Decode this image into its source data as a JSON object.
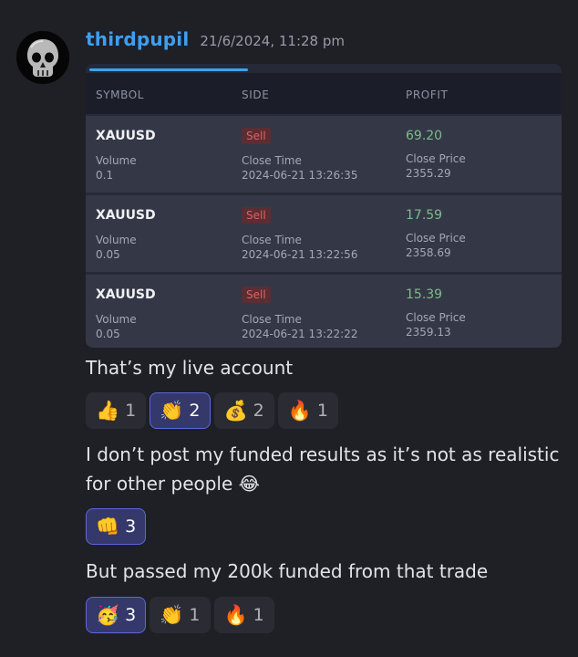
{
  "author": {
    "username": "thirdpupil",
    "timestamp": "21/6/2024, 11:28 pm"
  },
  "trade_card": {
    "columns": [
      "SYMBOL",
      "SIDE",
      "PROFIT"
    ],
    "rows": [
      {
        "symbol": "XAUUSD",
        "volume_label": "Volume",
        "volume": "0.1",
        "side": "Sell",
        "close_time_label": "Close Time",
        "close_time": "2024-06-21 13:26:35",
        "profit": "69.20",
        "close_price_label": "Close Price",
        "close_price": "2355.29"
      },
      {
        "symbol": "XAUUSD",
        "volume_label": "Volume",
        "volume": "0.05",
        "side": "Sell",
        "close_time_label": "Close Time",
        "close_time": "2024-06-21 13:22:56",
        "profit": "17.59",
        "close_price_label": "Close Price",
        "close_price": "2358.69"
      },
      {
        "symbol": "XAUUSD",
        "volume_label": "Volume",
        "volume": "0.05",
        "side": "Sell",
        "close_time_label": "Close Time",
        "close_time": "2024-06-21 13:22:22",
        "profit": "15.39",
        "close_price_label": "Close Price",
        "close_price": "2359.13"
      }
    ]
  },
  "messages": [
    {
      "text": "That’s my live account",
      "reactions": [
        {
          "emoji": "👍",
          "icon": "thumbs-up-icon",
          "count": "1",
          "active": false
        },
        {
          "emoji": "👏",
          "icon": "clapping-hands-icon",
          "count": "2",
          "active": true
        },
        {
          "emoji": "💰",
          "icon": "money-bag-icon",
          "count": "2",
          "active": false
        },
        {
          "emoji": "🔥",
          "icon": "fire-icon",
          "count": "1",
          "active": false
        }
      ]
    },
    {
      "text": "I don’t post my funded results as it’s not as realistic for other people 😂",
      "reactions": [
        {
          "emoji": "👊",
          "icon": "fist-bump-icon",
          "count": "3",
          "active": true
        }
      ]
    },
    {
      "text": "But passed my 200k funded from that trade",
      "reactions": [
        {
          "emoji": "🥳",
          "icon": "party-face-icon",
          "count": "3",
          "active": true
        },
        {
          "emoji": "👏",
          "icon": "clapping-hands-icon",
          "count": "1",
          "active": false
        },
        {
          "emoji": "🔥",
          "icon": "fire-icon",
          "count": "1",
          "active": false
        }
      ]
    }
  ],
  "colors": {
    "background": "#1f1f26",
    "username": "#3d9ff0",
    "sell": "#e0605e",
    "profit": "#7bbd89",
    "active_reaction": "#5c67dc"
  }
}
